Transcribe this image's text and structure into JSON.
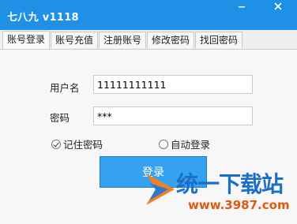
{
  "window": {
    "title": "七八九 v1118",
    "minimize_icon": "minimize-icon",
    "close_icon": "close-icon"
  },
  "tabs": [
    {
      "label": "账号登录",
      "active": true
    },
    {
      "label": "账号充值",
      "active": false
    },
    {
      "label": "注册账号",
      "active": false
    },
    {
      "label": "修改密码",
      "active": false
    },
    {
      "label": "找回密码",
      "active": false
    }
  ],
  "form": {
    "username_label": "用户名",
    "username_value": "11111111111",
    "password_label": "密码",
    "password_value": "***",
    "remember_label": "记住密码",
    "remember_checked": true,
    "autologin_label": "自动登录",
    "autologin_checked": false,
    "login_button": "登录"
  },
  "watermark": {
    "brand": "统一下载站",
    "url": "www.3987.com"
  },
  "colors": {
    "titlebar": "#1e90e6",
    "button": "#34a2f0",
    "watermark_blue": "#1b6fc7",
    "watermark_orange": "#e05a10"
  }
}
